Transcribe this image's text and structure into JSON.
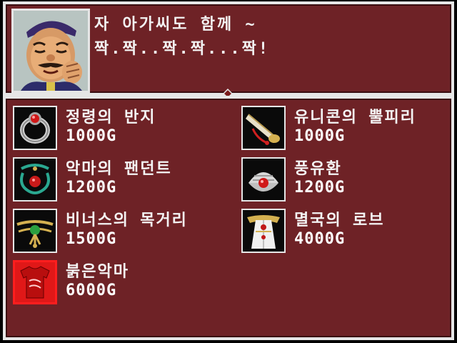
{
  "dialog": {
    "line1": "자 아가씨도 함께 ~",
    "line2": "짝.짝..짝.짝...짝!"
  },
  "shop": {
    "items": [
      {
        "name": "정령의 반지",
        "price": "1000G",
        "icon": "ring-icon"
      },
      {
        "name": "유니콘의 뿔피리",
        "price": "1000G",
        "icon": "horn-icon"
      },
      {
        "name": "악마의 팬던트",
        "price": "1200G",
        "icon": "pendant-icon"
      },
      {
        "name": "풍유환",
        "price": "1200G",
        "icon": "pearl-shell-icon"
      },
      {
        "name": "비너스의 목거리",
        "price": "1500G",
        "icon": "necklace-icon"
      },
      {
        "name": "멸국의 로브",
        "price": "4000G",
        "icon": "robe-icon"
      },
      {
        "name": "붉은악마",
        "price": "6000G",
        "icon": "red-shirt-icon"
      }
    ]
  },
  "colors": {
    "panel_bg": "#6e2226",
    "border": "#e6e6e6",
    "selection": "#ff1e1e"
  }
}
